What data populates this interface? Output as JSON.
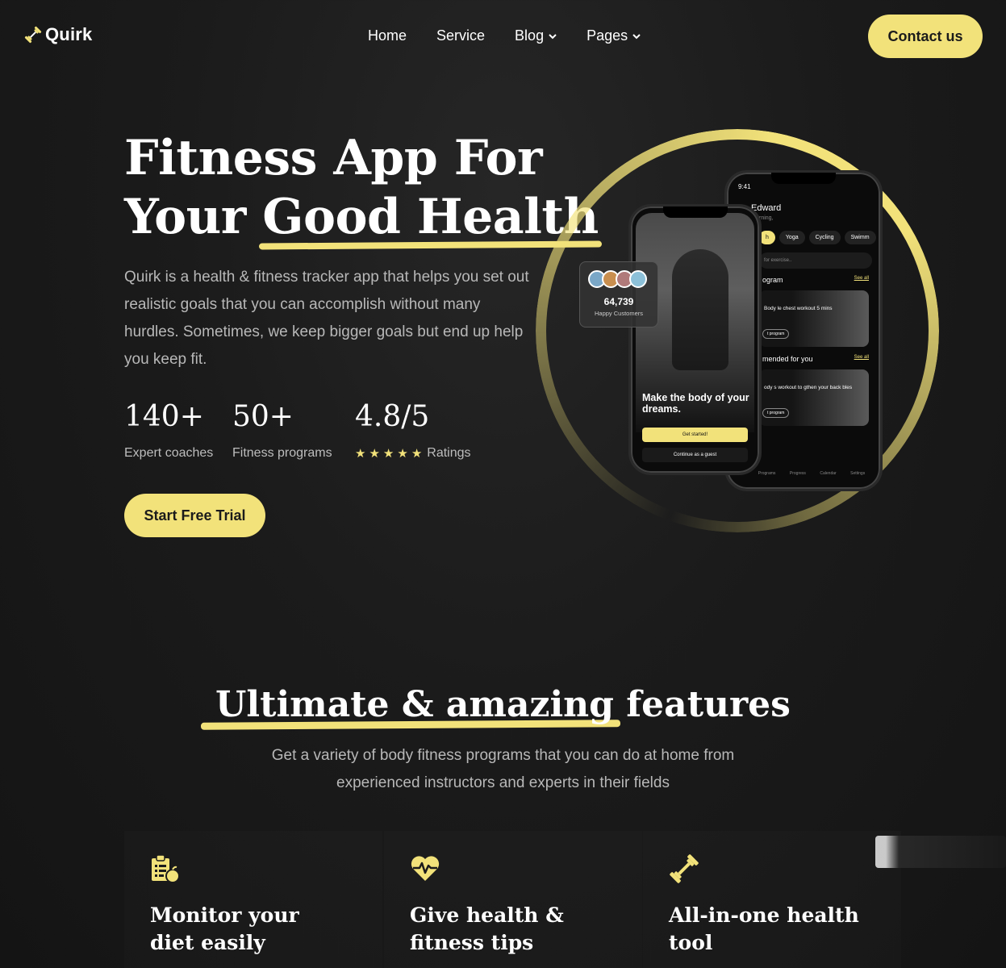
{
  "brand": {
    "name": "Quirk",
    "accent": "#f2e27a"
  },
  "nav": {
    "items": [
      {
        "label": "Home",
        "dropdown": false
      },
      {
        "label": "Service",
        "dropdown": false
      },
      {
        "label": "Blog",
        "dropdown": true
      },
      {
        "label": "Pages",
        "dropdown": true
      }
    ],
    "contact_label": "Contact us"
  },
  "hero": {
    "title_line1": "Fitness App For",
    "title_line2_plain": "Your ",
    "title_line2_highlight": "Good Health",
    "description": "Quirk is a health & fitness tracker app that helps you set out realistic goals that you can accomplish without many hurdles. Sometimes, we keep bigger goals but end up help you keep fit.",
    "stats": [
      {
        "value": "140+",
        "label": "Expert coaches"
      },
      {
        "value": "50+",
        "label": "Fitness programs"
      },
      {
        "value": "4.8/5",
        "label": "Ratings",
        "stars": 5
      }
    ],
    "cta_label": "Start Free Trial"
  },
  "customers_card": {
    "count": "64,739",
    "label": "Happy Customers"
  },
  "phone_front": {
    "headline": "Make the body of your dreams.",
    "primary_button": "Get started!",
    "secondary_button": "Continue as a guest"
  },
  "phone_back": {
    "time": "9:41",
    "user": "Edward",
    "greeting": "rning,",
    "chips": [
      "h",
      "Yoga",
      "Cycling",
      "Swimm"
    ],
    "search_placeholder": "for exercise..",
    "section1": "ogram",
    "section2": "mended for you",
    "see_all": "See all",
    "card1_text": "Body le chest workout 5 mins",
    "card2_text": "ody s workout to gthen your back bles",
    "card_button": "t program",
    "tabs": [
      "Programs",
      "Progress",
      "Calendar",
      "Settings"
    ]
  },
  "features": {
    "title_highlight": "Ultimate & amazing",
    "title_rest": " features",
    "description": "Get a variety of body fitness programs that you can do at home from experienced instructors and experts in their fields",
    "cards": [
      {
        "icon": "clipboard-apple-icon",
        "title": "Monitor your diet easily"
      },
      {
        "icon": "heartbeat-icon",
        "title": "Give health & fitness tips"
      },
      {
        "icon": "dumbbell-icon",
        "title": "All-in-one health tool"
      }
    ]
  }
}
